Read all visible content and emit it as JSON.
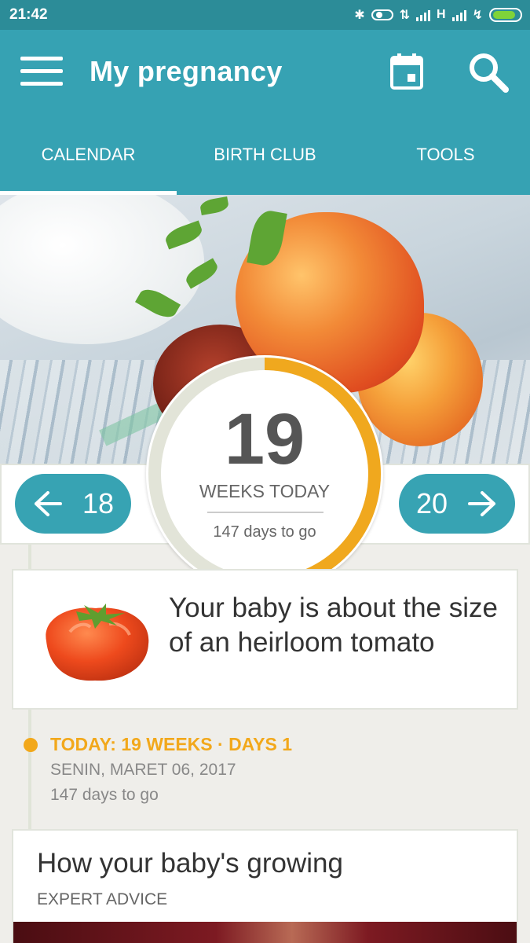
{
  "status_bar": {
    "time": "21:42",
    "network_label": "H",
    "battery_color": "#7fd33a"
  },
  "app_bar": {
    "title": "My pregnancy",
    "menu_icon": "hamburger-menu",
    "calendar_icon": "calendar",
    "search_icon": "search"
  },
  "tabs": [
    {
      "label": "CALENDAR",
      "selected": true
    },
    {
      "label": "BIRTH CLUB",
      "selected": false
    },
    {
      "label": "TOOLS",
      "selected": false
    }
  ],
  "week_nav": {
    "prev_week": "18",
    "next_week": "20"
  },
  "progress_dial": {
    "week": "19",
    "label": "WEEKS TODAY",
    "days_to_go": "147 days to go",
    "progress_fraction": 0.475,
    "progress_color": "#f0a81e",
    "track_color": "#e2e4d8",
    "marker_color": "#36a2b3"
  },
  "baby_size": {
    "text": "Your baby is about the size of an heirloom tomato",
    "icon": "heirloom-tomato"
  },
  "today": {
    "title": "TODAY: 19 WEEKS · DAYS 1",
    "date": "SENIN, MARET 06, 2017",
    "days_to_go": "147 days to go"
  },
  "article": {
    "title": "How your baby's growing",
    "subtitle": "EXPERT ADVICE"
  },
  "colors": {
    "primary": "#36a2b3",
    "status_bar": "#2c8c98",
    "accent": "#f2a81b",
    "background": "#efeeea"
  }
}
